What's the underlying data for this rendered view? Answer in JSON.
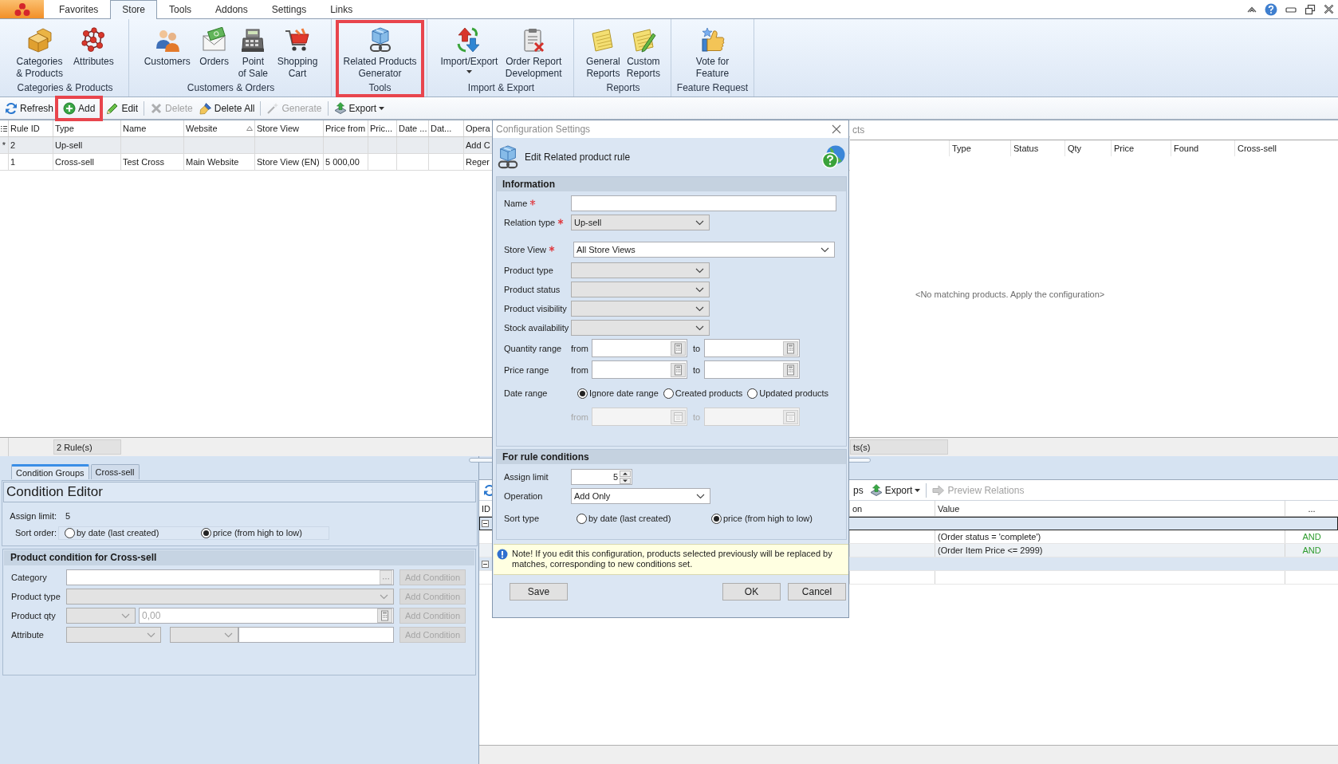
{
  "menu_tabs": [
    {
      "label": "Favorites",
      "selected": false
    },
    {
      "label": "Store",
      "selected": true
    },
    {
      "label": "Tools",
      "selected": false
    },
    {
      "label": "Addons",
      "selected": false
    },
    {
      "label": "Settings",
      "selected": false
    },
    {
      "label": "Links",
      "selected": false
    }
  ],
  "ribbon": {
    "groups": [
      {
        "label": "Categories & Products",
        "highlighted": false,
        "items": [
          {
            "label": "Categories\n& Products",
            "dropdown": false
          },
          {
            "label": "Attributes",
            "dropdown": false
          }
        ]
      },
      {
        "label": "Customers & Orders",
        "highlighted": false,
        "items": [
          {
            "label": "Customers",
            "dropdown": false
          },
          {
            "label": "Orders",
            "dropdown": false
          },
          {
            "label": "Point\nof Sale",
            "dropdown": false
          },
          {
            "label": "Shopping\nCart",
            "dropdown": false
          }
        ]
      },
      {
        "label": "Tools",
        "highlighted": true,
        "items": [
          {
            "label": "Related Products\nGenerator",
            "dropdown": false
          }
        ]
      },
      {
        "label": "Import & Export",
        "highlighted": false,
        "items": [
          {
            "label": "Import/Export",
            "dropdown": true
          },
          {
            "label": "Order Report\nDevelopment",
            "dropdown": false
          }
        ]
      },
      {
        "label": "Reports",
        "highlighted": false,
        "items": [
          {
            "label": "General\nReports",
            "dropdown": false
          },
          {
            "label": "Custom\nReports",
            "dropdown": false
          }
        ]
      },
      {
        "label": "Feature Request",
        "highlighted": false,
        "items": [
          {
            "label": "Vote for\nFeature",
            "dropdown": false
          }
        ]
      }
    ]
  },
  "toolbar": [
    {
      "kind": "button",
      "label": "Refresh",
      "disabled": false,
      "highlighted": false
    },
    {
      "kind": "button",
      "label": "Add",
      "disabled": false,
      "highlighted": true
    },
    {
      "kind": "button",
      "label": "Edit",
      "disabled": false,
      "highlighted": false
    },
    {
      "kind": "separator"
    },
    {
      "kind": "button",
      "label": "Delete",
      "disabled": true,
      "highlighted": false
    },
    {
      "kind": "button",
      "label": "Delete All",
      "disabled": false,
      "highlighted": false
    },
    {
      "kind": "separator"
    },
    {
      "kind": "button",
      "label": "Generate",
      "disabled": true,
      "highlighted": false
    },
    {
      "kind": "separator"
    },
    {
      "kind": "dropdown",
      "label": "Export",
      "disabled": false,
      "highlighted": false
    }
  ],
  "rules_grid": {
    "columns": [
      {
        "label": "Rule ID",
        "sorted": false
      },
      {
        "label": "Type",
        "sorted": false
      },
      {
        "label": "Name",
        "sorted": false
      },
      {
        "label": "Website",
        "sorted": true
      },
      {
        "label": "Store View",
        "sorted": false
      },
      {
        "label": "Price from",
        "sorted": false
      },
      {
        "label": "Pric...",
        "sorted": false
      },
      {
        "label": "Date ...",
        "sorted": false
      },
      {
        "label": "Dat...",
        "sorted": false
      },
      {
        "label": "Opera",
        "sorted": false
      }
    ],
    "rows": [
      {
        "indicator": "*",
        "selected": true,
        "cells": [
          "2",
          "Up-sell",
          null,
          null,
          null,
          null,
          null,
          null,
          null,
          "Add C"
        ]
      },
      {
        "selected": false,
        "cells": [
          "1",
          "Cross-sell",
          "Test Cross",
          "Main Website",
          "Store View (EN)",
          "5 000,00",
          null,
          null,
          null,
          "Reger"
        ]
      }
    ],
    "summary": "2 Rule(s)"
  },
  "products_panel": {
    "title": "cts",
    "columns": [
      "Type",
      "Status",
      "Qty",
      "Price",
      "Found",
      "Cross-sell"
    ],
    "empty_message": "<No matching products. Apply the configuration>",
    "summary": "ts(s)"
  },
  "bottom_tabs": [
    {
      "label": "Condition Groups",
      "selected": true
    },
    {
      "label": "Cross-sell",
      "selected": false
    }
  ],
  "condition_editor": {
    "title": "Condition Editor",
    "assign_limit": {
      "label": "Assign limit:",
      "value": "5"
    },
    "sort_order": {
      "label": "Sort order:",
      "options": [
        {
          "label": "by date (last created)",
          "selected": false
        },
        {
          "label": "price (from high to low)",
          "selected": true
        }
      ]
    },
    "product_condition": {
      "title": "Product condition for Cross-sell",
      "rows": [
        {
          "kind": "browse",
          "label": "Category",
          "button": {
            "label": "Add Condition",
            "disabled": true
          }
        },
        {
          "kind": "list",
          "label": "Product type",
          "button": {
            "label": "Add Condition",
            "disabled": true
          }
        },
        {
          "kind": "quantity",
          "label": "Product qty",
          "placeholder": "0,00",
          "button": {
            "label": "Add Condition",
            "disabled": true
          }
        },
        {
          "kind": "attribute",
          "label": "Attribute",
          "button": {
            "label": "Add Condition",
            "disabled": true
          }
        }
      ]
    }
  },
  "conditions_panel": {
    "toolbar": [
      {
        "kind": "icon",
        "disabled": false
      },
      {
        "kind": "button",
        "label": "ps",
        "disabled": false
      },
      {
        "kind": "dropdown",
        "label": "Export",
        "disabled": false
      },
      {
        "kind": "separator"
      },
      {
        "kind": "button",
        "label": "Preview Relations",
        "disabled": true
      }
    ],
    "columns": [
      "ID",
      "on",
      "Value",
      "..."
    ],
    "rows": [
      {
        "kind": "group",
        "expanded": true,
        "selected": true
      },
      {
        "kind": "condition",
        "selected": false,
        "value": "(Order status = 'complete')",
        "operator": "AND"
      },
      {
        "kind": "condition",
        "selected": false,
        "value": "(Order Item Price <= 2999)",
        "operator": "AND"
      },
      {
        "kind": "group",
        "expanded": true,
        "selected": false
      },
      {
        "kind": "condition",
        "selected": false
      }
    ]
  },
  "dialog": {
    "title": "Configuration Settings",
    "heading": "Edit Related product rule",
    "information": {
      "title": "Information",
      "fields": [
        {
          "kind": "text",
          "label": "Name",
          "required": true
        },
        {
          "kind": "list",
          "label": "Relation type",
          "required": true,
          "value": "Up-sell"
        },
        {
          "kind": "combo",
          "label": "Store View",
          "required": true,
          "value": "All Store Views"
        },
        {
          "kind": "list",
          "label": "Product type",
          "required": false
        },
        {
          "kind": "list",
          "label": "Product status",
          "required": false
        },
        {
          "kind": "list",
          "label": "Product visibility",
          "required": false
        },
        {
          "kind": "list",
          "label": "Stock availability",
          "required": false
        },
        {
          "kind": "range",
          "label": "Quantity range",
          "required": false,
          "from_label": "from",
          "to_label": "to",
          "disabled": false
        },
        {
          "kind": "range",
          "label": "Price range",
          "required": false,
          "from_label": "from",
          "to_label": "to",
          "disabled": false
        },
        {
          "kind": "radios",
          "label": "Date range",
          "required": false,
          "options": [
            {
              "label": "Ignore date range",
              "selected": true
            },
            {
              "label": "Created products",
              "selected": false
            },
            {
              "label": "Updated products",
              "selected": false
            }
          ]
        },
        {
          "kind": "date_range",
          "from_label": "from",
          "to_label": "to",
          "disabled": true
        }
      ]
    },
    "rule_conditions": {
      "title": "For rule conditions",
      "fields": [
        {
          "kind": "spinner",
          "label": "Assign limit",
          "required": false,
          "value": "5"
        },
        {
          "kind": "combo",
          "label": "Operation",
          "required": false,
          "value": "Add Only"
        },
        {
          "kind": "radios",
          "label": "Sort type",
          "required": false,
          "options": [
            {
              "label": "by date (last created)",
              "selected": false
            },
            {
              "label": "price (from high to low)",
              "selected": true
            }
          ]
        }
      ]
    },
    "note": "Note! If you edit this configuration, products selected previously will be replaced by matches, corresponding to new conditions set.",
    "buttons": [
      {
        "label": "Save"
      },
      {
        "label": "OK"
      },
      {
        "label": "Cancel"
      }
    ]
  }
}
